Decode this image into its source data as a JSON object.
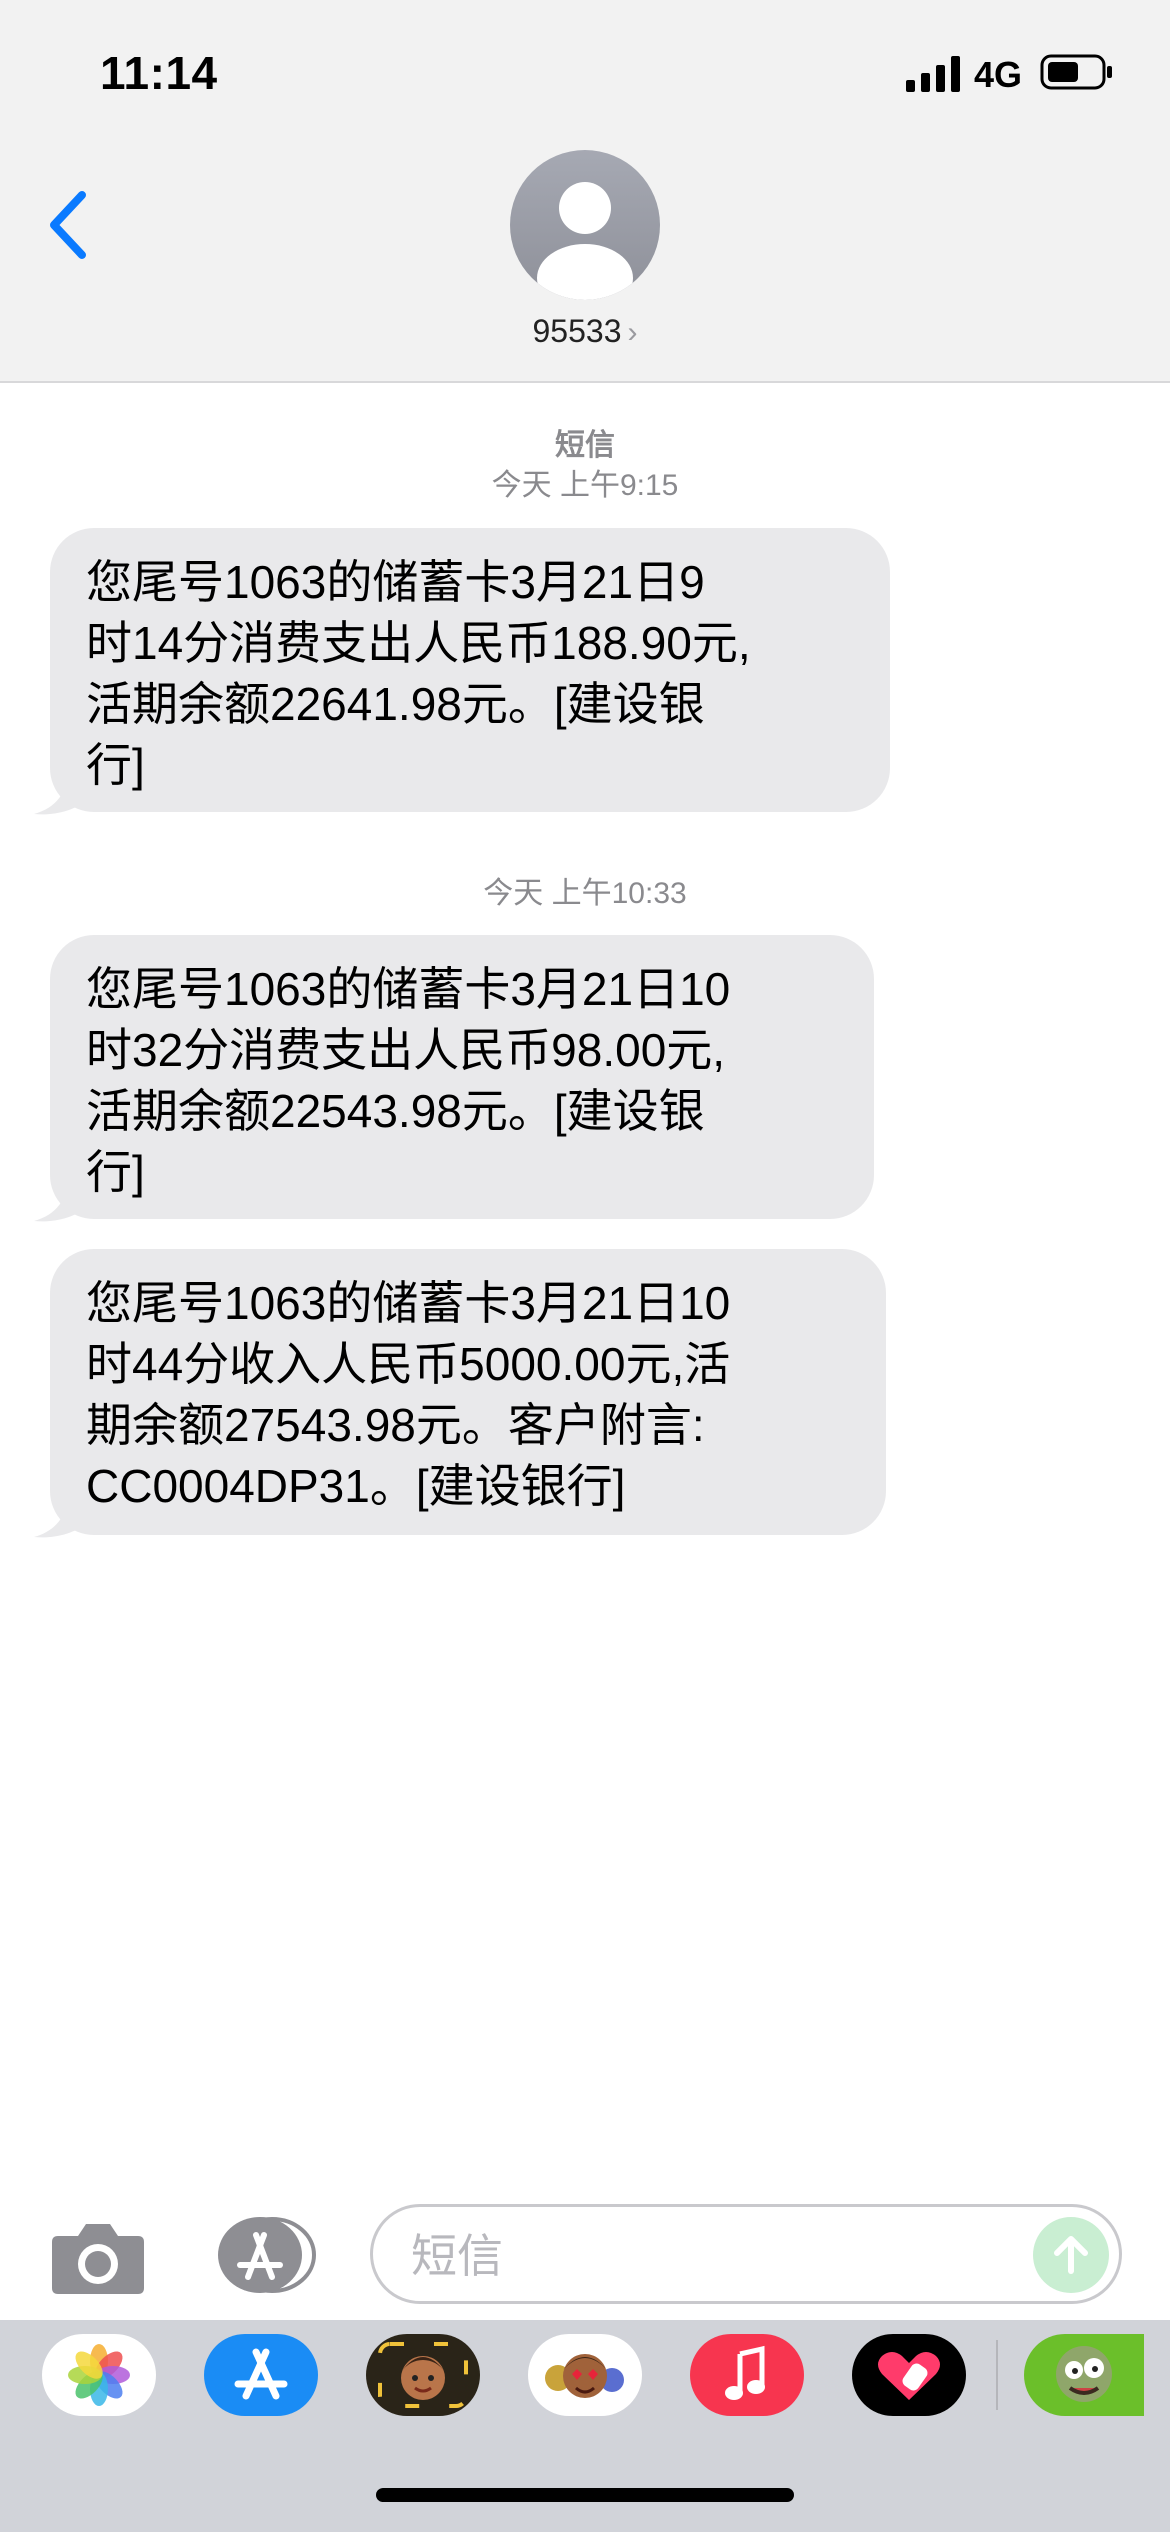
{
  "status_bar": {
    "time": "11:14",
    "network": "4G"
  },
  "contact": {
    "number": "95533",
    "chevron": "›"
  },
  "messages": [
    {
      "meta_title": "短信",
      "timestamp": "今天 上午9:15",
      "lines": [
        "您尾号1063的储蓄卡3月21日9",
        "时14分消费支出人民币188.90元,",
        "活期余额22641.98元。[建设银",
        "行]"
      ]
    },
    {
      "timestamp": "今天 上午10:33",
      "lines": [
        "您尾号1063的储蓄卡3月21日10",
        "时32分消费支出人民币98.00元,",
        "活期余额22543.98元。[建设银",
        "行]"
      ]
    },
    {
      "lines": [
        "您尾号1063的储蓄卡3月21日10",
        "时44分收入人民币5000.00元,活",
        "期余额27543.98元。客户附言:",
        "CC0004DP31。[建设银行]"
      ]
    }
  ],
  "composer": {
    "placeholder": "短信"
  },
  "tray_apps": [
    "photos-icon",
    "app-store-icon",
    "memoji-icon",
    "animoji-icon",
    "music-icon",
    "heart-sticker-icon",
    "game-icon"
  ],
  "colors": {
    "accent_blue": "#0a7aff",
    "bubble_gray": "#e9e9eb",
    "send_green": "#c9eed2"
  }
}
